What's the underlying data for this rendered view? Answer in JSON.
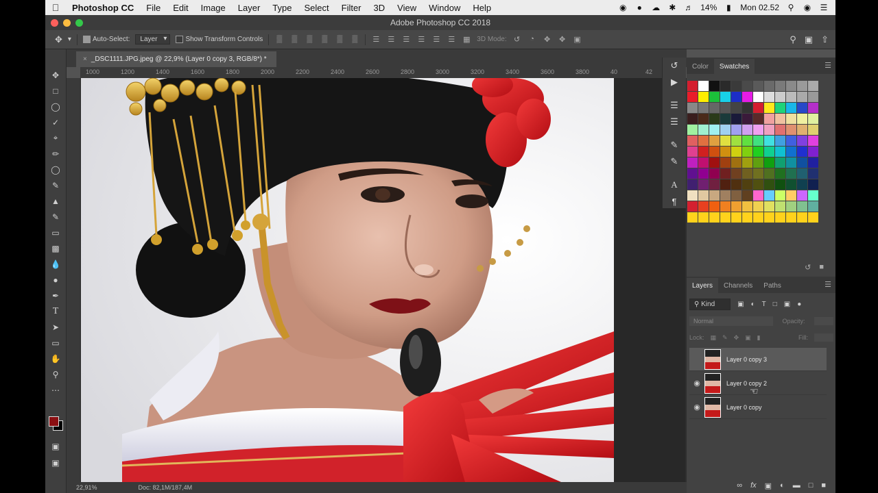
{
  "menubar": {
    "app": "Photoshop CC",
    "items": [
      "File",
      "Edit",
      "Image",
      "Layer",
      "Type",
      "Select",
      "Filter",
      "3D",
      "View",
      "Window",
      "Help"
    ],
    "battery": "14%",
    "clock": "Mon 02.52"
  },
  "titlebar": {
    "title": "Adobe Photoshop CC 2018"
  },
  "options": {
    "auto_select_label": "Auto-Select:",
    "auto_select_value": "Layer",
    "show_transform_label": "Show Transform Controls",
    "mode_label": "3D Mode:"
  },
  "document": {
    "tab_title": "_DSC1111.JPG.jpeg @ 22,9% (Layer 0 copy 3, RGB/8*) *",
    "zoom": "22,91%",
    "doc_info": "Doc: 82,1M/187,4M"
  },
  "ruler_ticks": [
    "1000",
    "1200",
    "1400",
    "1600",
    "1800",
    "2000",
    "2200",
    "2400",
    "2600",
    "2800",
    "3000",
    "3200",
    "3400",
    "3600",
    "3800",
    "40",
    "42"
  ],
  "panels": {
    "color_tab": "Color",
    "swatches_tab": "Swatches",
    "layers_tab": "Layers",
    "channels_tab": "Channels",
    "paths_tab": "Paths",
    "filter_kind": "Kind",
    "blend_mode": "Normal",
    "opacity_label": "Opacity:",
    "lock_label": "Lock:",
    "fill_label": "Fill:"
  },
  "layers": [
    {
      "name": "Layer 0 copy 3",
      "visible": false,
      "selected": true
    },
    {
      "name": "Layer 0 copy 2",
      "visible": true,
      "selected": false
    },
    {
      "name": "Layer 0 copy",
      "visible": true,
      "selected": false
    }
  ],
  "swatch_rows": [
    [
      "#d41e2f",
      "#ffffff",
      "#111111",
      "#2a2a2a",
      "#3a3a3a",
      "#4a4a4a",
      "#5a5a5a",
      "#6a6a6a",
      "#7a7a7a",
      "#8a8a8a",
      "#9a9a9a",
      "#aaaaaa"
    ],
    [
      "#e91c2a",
      "#ffee00",
      "#1cbf3a",
      "#18d0e8",
      "#1c2ec8",
      "#e51ce5",
      "#ffffff",
      "#dddddd",
      "#cccccc",
      "#bbbbbb",
      "#aaaaaa",
      "#999999"
    ],
    [
      "#888888",
      "#777777",
      "#666666",
      "#555555",
      "#444444",
      "#333333",
      "#d41e2f",
      "#ffe81c",
      "#1ed37a",
      "#19b6e8",
      "#2748c8",
      "#b52fc9"
    ],
    [
      "#3a1e1e",
      "#4a2a1a",
      "#2a3a1a",
      "#1a3a3a",
      "#1a1a3a",
      "#3a1a3a",
      "#5a2a2a",
      "#f0a0a0",
      "#f0c0a0",
      "#f0e0a0",
      "#f0f0a0",
      "#e0f0a0"
    ],
    [
      "#a0f0a0",
      "#a0f0d0",
      "#a0f0f0",
      "#a0d0f0",
      "#a0a0f0",
      "#d0a0f0",
      "#f0a0f0",
      "#f0a0c0",
      "#e07070",
      "#e09070",
      "#e0b070",
      "#e0d070"
    ],
    [
      "#e06060",
      "#e07040",
      "#e0a040",
      "#e0e040",
      "#a0e040",
      "#60e040",
      "#40e080",
      "#40e0e0",
      "#40a0e0",
      "#4060e0",
      "#8040e0",
      "#e040e0"
    ],
    [
      "#e04090",
      "#d02020",
      "#d05010",
      "#d09010",
      "#d0d010",
      "#80d010",
      "#20d020",
      "#10d090",
      "#10c0d0",
      "#1070d0",
      "#2030d0",
      "#8020d0"
    ],
    [
      "#c020c0",
      "#c01070",
      "#a01010",
      "#a04010",
      "#a07010",
      "#a0a010",
      "#60a010",
      "#10a010",
      "#10a070",
      "#1090a0",
      "#1050a0",
      "#2020a0"
    ],
    [
      "#601090",
      "#900090",
      "#900050",
      "#702020",
      "#704020",
      "#706020",
      "#707020",
      "#507020",
      "#207020",
      "#207050",
      "#206070",
      "#203070"
    ],
    [
      "#402070",
      "#702070",
      "#702040",
      "#502010",
      "#503010",
      "#504010",
      "#505010",
      "#305010",
      "#105010",
      "#105030",
      "#104050",
      "#102050"
    ],
    [
      "#f0e0c0",
      "#e0c8a0",
      "#c8a880",
      "#a08060",
      "#806040",
      "#604020",
      "#ff66cc",
      "#66ccff",
      "#ccff66",
      "#ffcc66",
      "#cc66ff",
      "#66ffcc"
    ],
    [
      "#d42030",
      "#e84020",
      "#f06010",
      "#f08020",
      "#f0a030",
      "#f0c040",
      "#f0d050",
      "#e0e060",
      "#c0e070",
      "#a0d080",
      "#80c090",
      "#60b0a0"
    ],
    [
      "#ffd21c",
      "#ffd21c",
      "#ffd21c",
      "#ffd21c",
      "#ffd21c",
      "#ffd21c",
      "#ffd21c",
      "#ffd21c",
      "#ffd21c",
      "#ffd21c",
      "#ffd21c",
      "#ffd21c"
    ]
  ]
}
